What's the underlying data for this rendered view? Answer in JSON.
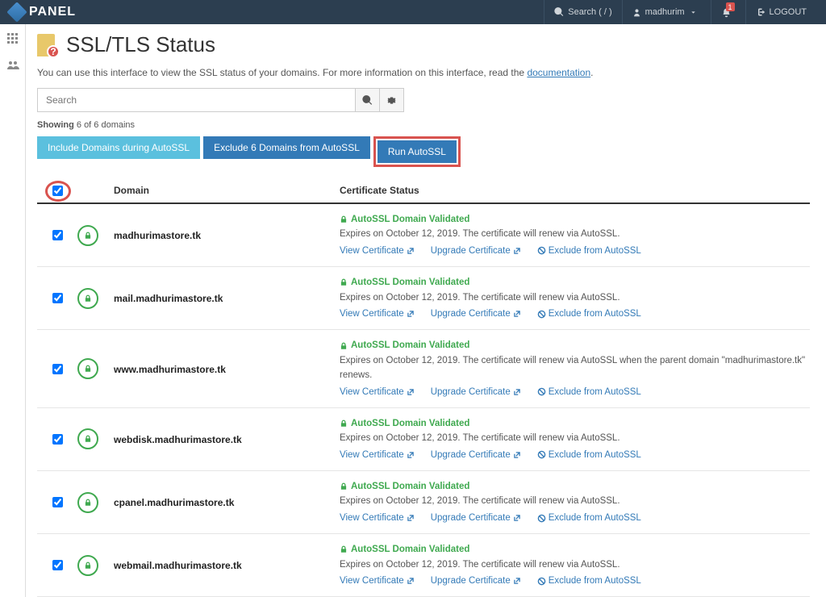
{
  "header": {
    "brand": "PANEL",
    "search_placeholder": "Search ( / )",
    "user": "madhurim",
    "notif_count": "1",
    "logout": "LOGOUT"
  },
  "page": {
    "title": "SSL/TLS Status",
    "intro_pre": "You can use this interface to view the SSL status of your domains. For more information on this interface, read the ",
    "intro_link": "documentation",
    "intro_post": "."
  },
  "search": {
    "placeholder": "Search"
  },
  "showing": {
    "label": "Showing",
    "count": "6 of 6 domains"
  },
  "buttons": {
    "include": "Include Domains during AutoSSL",
    "exclude": "Exclude 6 Domains from AutoSSL",
    "run": "Run AutoSSL"
  },
  "columns": {
    "domain": "Domain",
    "status": "Certificate Status"
  },
  "status_text": {
    "validated": "AutoSSL Domain Validated",
    "expire_renew": "Expires on October 12, 2019. The certificate will renew via AutoSSL.",
    "expire_parent": "Expires on October 12, 2019. The certificate will renew via AutoSSL when the parent domain \"madhurimastore.tk\" renews.",
    "view": "View Certificate",
    "upgrade": "Upgrade Certificate",
    "exclude": "Exclude from AutoSSL"
  },
  "domains": [
    {
      "name": "madhurimastore.tk",
      "parent": false
    },
    {
      "name": "mail.madhurimastore.tk",
      "parent": false
    },
    {
      "name": "www.madhurimastore.tk",
      "parent": true
    },
    {
      "name": "webdisk.madhurimastore.tk",
      "parent": false
    },
    {
      "name": "cpanel.madhurimastore.tk",
      "parent": false
    },
    {
      "name": "webmail.madhurimastore.tk",
      "parent": false
    }
  ]
}
